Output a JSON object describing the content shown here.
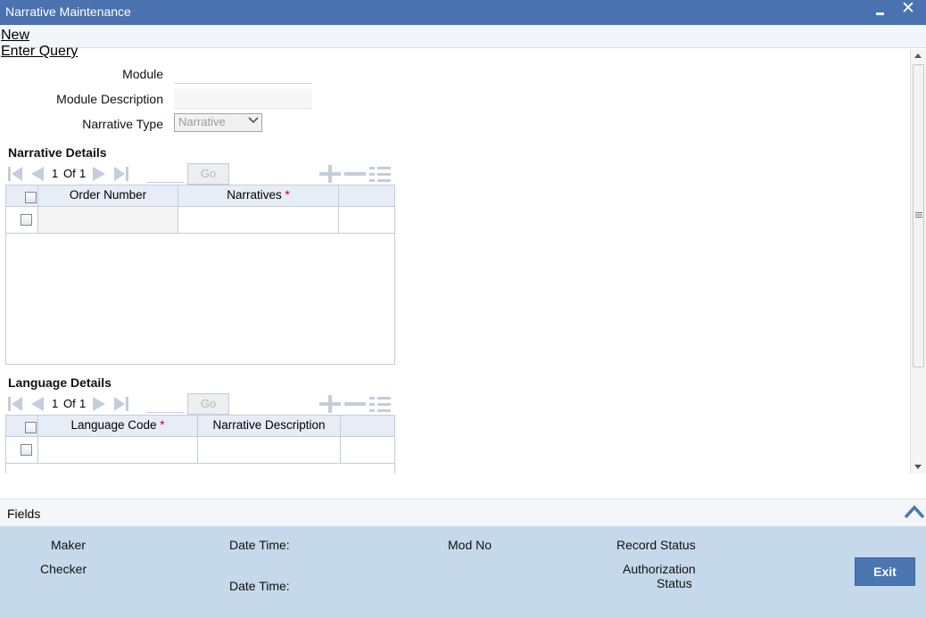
{
  "window": {
    "title": "Narrative Maintenance"
  },
  "actions": {
    "new": "New",
    "enter_query": "Enter Query"
  },
  "form": {
    "module_label": "Module",
    "module_value": "",
    "module_description_label": "Module Description",
    "module_description_value": "",
    "narrative_type_label": "Narrative Type",
    "narrative_type_value": "Narrative"
  },
  "narrative_details": {
    "title": "Narrative Details",
    "page": "1",
    "of_label": "Of",
    "total": "1",
    "go_label": "Go",
    "columns": [
      "Order Number",
      "Narratives"
    ],
    "required_mark": "*",
    "rows": [
      [
        "",
        ""
      ]
    ]
  },
  "language_details": {
    "title": "Language Details",
    "page": "1",
    "of_label": "Of",
    "total": "1",
    "go_label": "Go",
    "columns": [
      "Language Code",
      "Narrative Description"
    ],
    "required_mark": "*",
    "rows": [
      [
        "",
        ""
      ]
    ]
  },
  "fields_bar": {
    "label": "Fields"
  },
  "audit": {
    "maker": "Maker",
    "checker": "Checker",
    "date_time_1": "Date Time:",
    "date_time_2": "Date Time:",
    "mod_no": "Mod No",
    "record_status": "Record Status",
    "authorization": "Authorization",
    "status": "Status",
    "exit": "Exit"
  },
  "colors": {
    "title_bar": "#4a72b0",
    "audit_bg": "#c5d9ea",
    "exit_button": "#4a77b2",
    "required": "#cc0000"
  }
}
